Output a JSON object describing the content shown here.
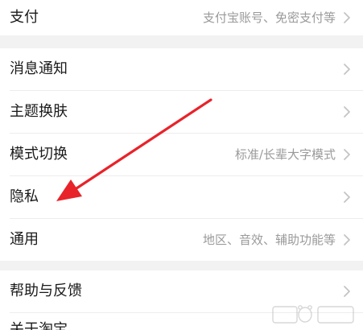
{
  "settings": {
    "items": [
      {
        "label": "支付",
        "value": "支付宝账号、免密支付等"
      },
      {
        "label": "消息通知",
        "value": ""
      },
      {
        "label": "主题换肤",
        "value": ""
      },
      {
        "label": "模式切换",
        "value": "标准/长辈大字模式"
      },
      {
        "label": "隐私",
        "value": ""
      },
      {
        "label": "通用",
        "value": "地区、音效、辅助功能等"
      },
      {
        "label": "帮助与反馈",
        "value": ""
      },
      {
        "label": "关于淘宝",
        "value": ""
      }
    ]
  },
  "annotation": {
    "color": "#e8232a",
    "points_to": "隐私"
  },
  "icons": {
    "chevron": "chevron-right-icon",
    "chevron_color": "#c4c4c4",
    "watermark": "baidu-jingyan-watermark"
  },
  "colors": {
    "background": "#ffffff",
    "section_gap": "#f2f2f2",
    "label": "#1a1a1a",
    "value": "#9a9a9a"
  }
}
